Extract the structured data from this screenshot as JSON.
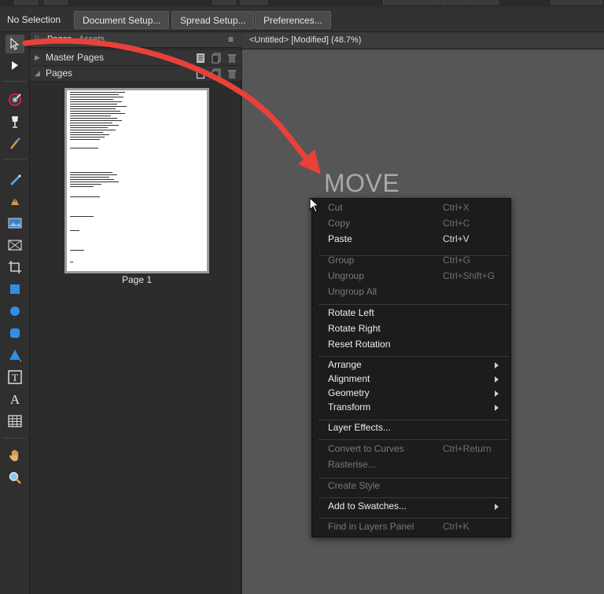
{
  "context_toolbar": {
    "selection_label": "No Selection",
    "buttons": [
      "Document Setup...",
      "Spread Setup...",
      "Preferences..."
    ]
  },
  "panel": {
    "tabs": [
      "Pages",
      "Assets"
    ],
    "sections": {
      "master_pages": "Master Pages",
      "pages": "Pages"
    },
    "page_label": "Page 1"
  },
  "document": {
    "tab_title": "<Untitled> [Modified] (48.7%)"
  },
  "canvas": {
    "annotation": "MOVE"
  },
  "context_menu": {
    "items": [
      {
        "label": "Cut",
        "shortcut": "Ctrl+X",
        "enabled": false
      },
      {
        "label": "Copy",
        "shortcut": "Ctrl+C",
        "enabled": false
      },
      {
        "label": "Paste",
        "shortcut": "Ctrl+V",
        "enabled": true
      },
      {
        "label": "Group",
        "shortcut": "Ctrl+G",
        "enabled": false
      },
      {
        "label": "Ungroup",
        "shortcut": "Ctrl+Shift+G",
        "enabled": false
      },
      {
        "label": "Ungroup All",
        "shortcut": "",
        "enabled": false
      },
      {
        "label": "Rotate Left",
        "shortcut": "",
        "enabled": true
      },
      {
        "label": "Rotate Right",
        "shortcut": "",
        "enabled": true
      },
      {
        "label": "Reset Rotation",
        "shortcut": "",
        "enabled": true
      },
      {
        "label": "Arrange",
        "submenu": true,
        "enabled": true
      },
      {
        "label": "Alignment",
        "submenu": true,
        "enabled": true
      },
      {
        "label": "Geometry",
        "submenu": true,
        "enabled": true
      },
      {
        "label": "Transform",
        "submenu": true,
        "enabled": true
      },
      {
        "label": "Layer Effects...",
        "shortcut": "",
        "enabled": true
      },
      {
        "label": "Convert to Curves",
        "shortcut": "Ctrl+Return",
        "enabled": false
      },
      {
        "label": "Rasterise...",
        "shortcut": "",
        "enabled": false
      },
      {
        "label": "Create Style",
        "shortcut": "",
        "enabled": false
      },
      {
        "label": "Add to Swatches...",
        "submenu": true,
        "enabled": true
      },
      {
        "label": "Find in Layers Panel",
        "shortcut": "Ctrl+K",
        "enabled": false
      }
    ]
  },
  "colors": {
    "accent_arrow": "#e8413a",
    "menu_bg": "#1c1c1c",
    "canvas_bg": "#565656"
  },
  "icons": [
    "move-tool-icon",
    "node-tool-icon",
    "color-picker-icon",
    "fill-icon",
    "brush-icon",
    "pencil-icon",
    "pen-icon",
    "image-icon",
    "picture-frame-icon",
    "crop-icon",
    "rectangle-icon",
    "ellipse-icon",
    "rounded-rect-icon",
    "triangle-icon",
    "text-frame-icon",
    "artistic-text-icon",
    "table-icon",
    "hand-icon",
    "zoom-icon"
  ]
}
